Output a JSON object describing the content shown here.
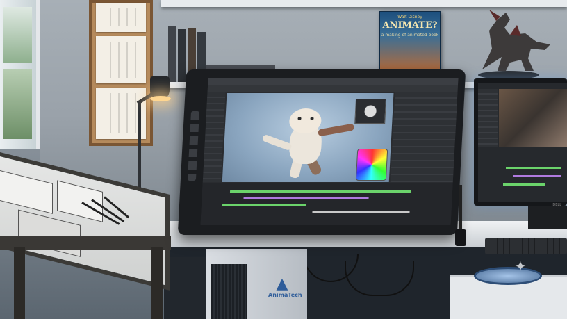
{
  "scene": {
    "description_type": "photo",
    "book": {
      "publisher": "Walt Disney",
      "title": "ANIMATE?",
      "subtitle": "a making of animated book"
    },
    "tower_brand": "AnimaTech",
    "monitor_brand": "DELL"
  },
  "colors": {
    "screen_blue": "#8aa5bf",
    "lamp_glow": "#ffd690",
    "timeline_green": "#6bd36b",
    "timeline_purple": "#b07ae0",
    "wall": "#9aa2aa"
  },
  "icons": {
    "sparkle": "sparkle-icon"
  }
}
